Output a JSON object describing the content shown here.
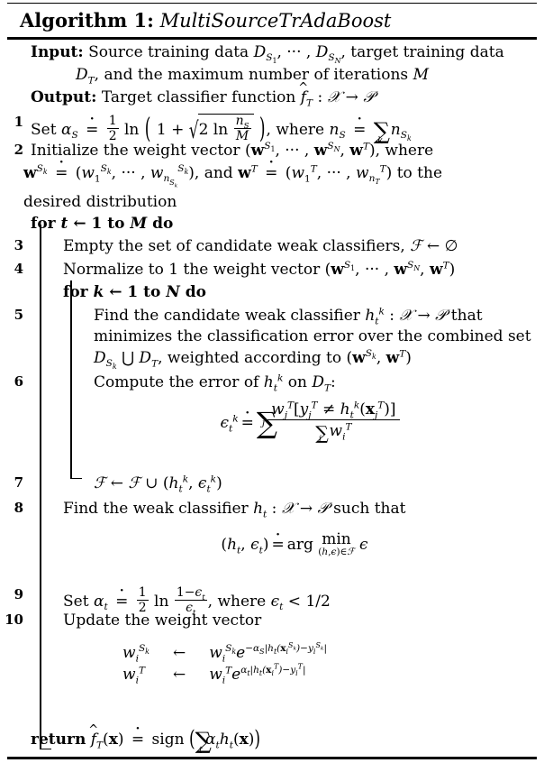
{
  "title": {
    "label": "Algorithm 1:",
    "name": "MultiSourceTrAdaBoost"
  },
  "io": {
    "input_label": "Input:",
    "input_line1": "Source training data D_{S_1}, ··· , D_{S_N}, target training data",
    "input_line2": "D_T, and the maximum number of iterations M",
    "output_label": "Output:",
    "output_text": "Target classifier function f̂_T : X → Y"
  },
  "lines": [
    {
      "no": "1",
      "text": "Set α_S ≐ ½ ln(1 + √(2 ln n_S/M)), where n_S ≐ ∑_k n_{S_k}"
    },
    {
      "no": "2",
      "text": "Initialize the weight vector (w^{S_1}, ··· , w^{S_N}, w^T), where w^{S_k} ≐ (w_1^{S_k}, ··· , w_{n_{S_k}}^{S_k}), and w^T ≐ (w_1^T, ··· , w_{n_T}^T) to the desired distribution"
    },
    {
      "no": "",
      "text": "for t ← 1 to M do"
    },
    {
      "no": "3",
      "text": "Empty the set of candidate weak classifiers, F ← ∅"
    },
    {
      "no": "4",
      "text": "Normalize to 1 the weight vector (w^{S_1}, ··· , w^{S_N}, w^T)"
    },
    {
      "no": "",
      "text": "for k ← 1 to N do"
    },
    {
      "no": "5",
      "text": "Find the candidate weak classifier h_t^k : X → Y that minimizes the classification error over the combined set D_{S_k} ⋃ D_T, weighted according to (w^{S_k}, w^T)"
    },
    {
      "no": "6",
      "text": "Compute the error of h_t^k on D_T:"
    },
    {
      "no": "7",
      "text": "F ← F ∪ (h_t^k, ϵ_t^k)"
    },
    {
      "no": "8",
      "text": "Find the weak classifier h_t : X → Y such that"
    },
    {
      "no": "9",
      "text": "Set α_t ≐ ½ ln (1−ϵ_t)/ϵ_t, where ϵ_t < 1/2"
    },
    {
      "no": "10",
      "text": "Update the weight vector"
    }
  ],
  "equations": {
    "error": "ϵ_t^k ≐ ∑_j  w_j^T[y_j^T ≠ h_t^k(x_j^T)] / ∑_i w_i^T",
    "argmin": "(h_t, ϵ_t) ≐ arg min_{(h,ϵ)∈F} ϵ",
    "update_source": "w_i^{S_k} ← w_i^{S_k} e^{−α_S|h_t(x_i^{S_k})−y_i^{S_k}|}",
    "update_target": "w_i^T ← w_i^T e^{α_t|h_t(x_i^T)−y_i^T|}"
  },
  "return": {
    "keyword": "return",
    "expression": "f̂_T(x) ≐ sign (∑_t α_t h_t(x))"
  },
  "keywords": {
    "for": "for",
    "do": "do",
    "to": "to",
    "t_var": "t",
    "k_var": "k",
    "m_var": "M",
    "n_var": "N",
    "one": "1"
  },
  "colors": {
    "ink": "#000000",
    "paper": "#ffffff"
  }
}
